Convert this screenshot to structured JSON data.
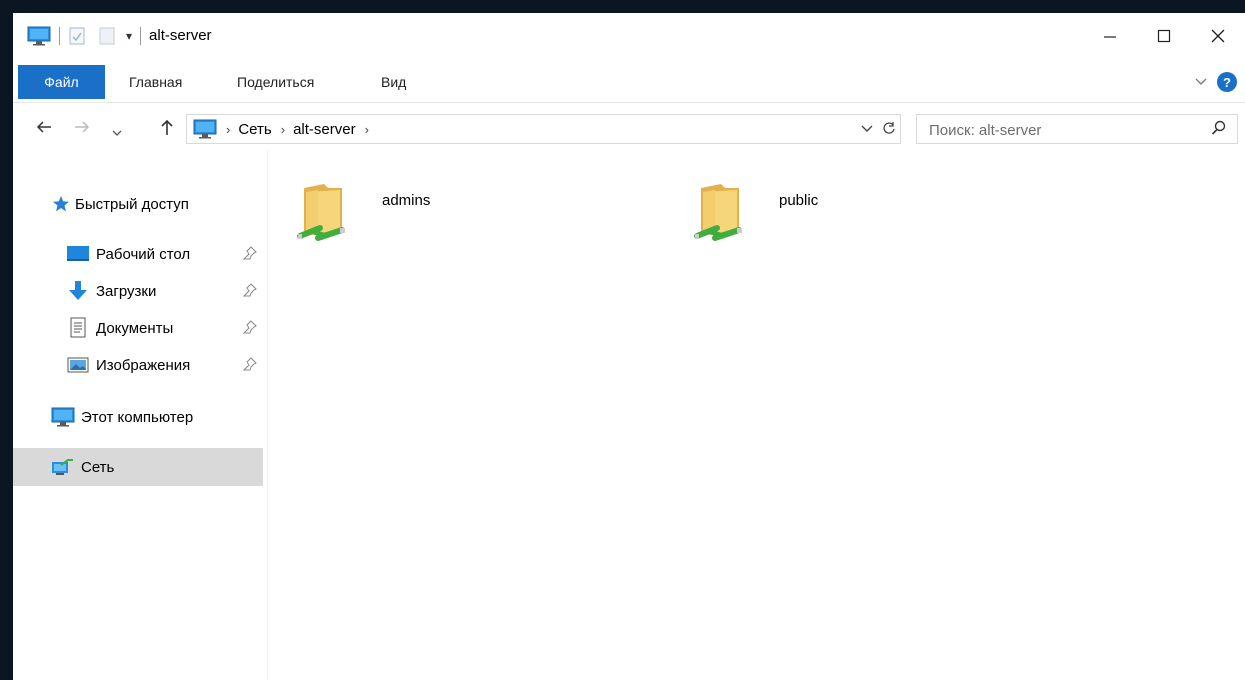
{
  "window": {
    "title": "alt-server"
  },
  "ribbon": {
    "tabs": [
      {
        "label": "Файл"
      },
      {
        "label": "Главная"
      },
      {
        "label": "Поделиться"
      },
      {
        "label": "Вид"
      }
    ],
    "help_label": "?"
  },
  "address": {
    "crumbs": [
      "Сеть",
      "alt-server"
    ]
  },
  "search": {
    "placeholder": "Поиск: alt-server"
  },
  "sidebar": {
    "items": [
      {
        "label": "Быстрый доступ"
      },
      {
        "label": "Рабочий стол"
      },
      {
        "label": "Загрузки"
      },
      {
        "label": "Документы"
      },
      {
        "label": "Изображения"
      },
      {
        "label": "Этот компьютер"
      },
      {
        "label": "Сеть"
      }
    ]
  },
  "content": {
    "folders": [
      {
        "name": "admins"
      },
      {
        "name": "public"
      }
    ]
  },
  "colors": {
    "accent": "#1a6fc7",
    "selection": "#d9d9d9",
    "folder": "#f2ce6e",
    "share": "#3fae3f"
  }
}
